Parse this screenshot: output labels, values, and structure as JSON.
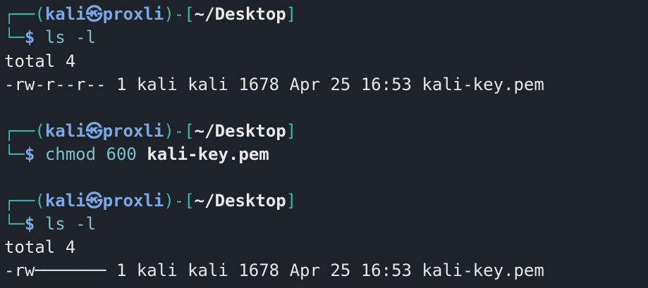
{
  "prompt": {
    "corner_top": "┌──",
    "corner_bottom": "└─",
    "open_paren": "(",
    "user": "kali",
    "at_symbol": "㉿",
    "host": "proxli",
    "close_paren_bracket": ")-[",
    "cwd": "~/Desktop",
    "close_bracket": "]",
    "dollar": "$"
  },
  "blocks": [
    {
      "command": "ls",
      "args": "-l",
      "output": [
        "total 4",
        "-rw-r--r-- 1 kali kali 1678 Apr 25 16:53 kali-key.pem"
      ]
    },
    {
      "command": "chmod",
      "args": "600",
      "file_arg": "kali-key.pem",
      "output": []
    },
    {
      "command": "ls",
      "args": "-l",
      "output": [
        "total 4",
        "-rw─────── 1 kali kali 1678 Apr 25 16:53 kali-key.pem"
      ]
    }
  ],
  "colors": {
    "background": "#1e2229",
    "prompt_lines": "#38b8aa",
    "user_host": "#7aa8e6",
    "command": "#7ac0c8",
    "text": "#e6e6e6"
  }
}
